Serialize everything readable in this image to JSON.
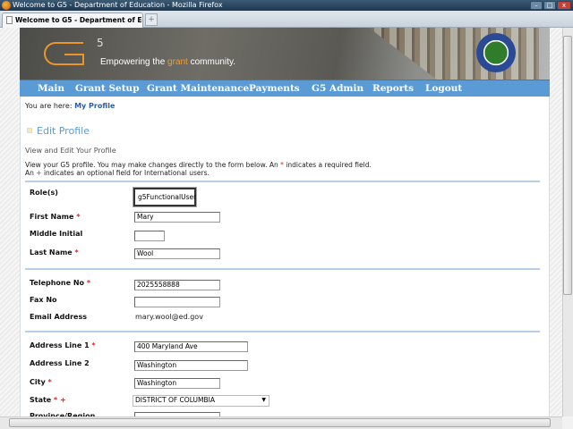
{
  "window": {
    "title": "Welcome to G5 - Department of Education - Mozilla Firefox",
    "tab_label": "Welcome to G5 - Department of Edu...",
    "new_tab": "+"
  },
  "banner": {
    "logo_sup": "5",
    "tagline_pre": "Empowering the ",
    "tagline_hl": "grant",
    "tagline_post": " community."
  },
  "nav": [
    "Main",
    "Grant Setup",
    "Grant Maintenance",
    "Payments",
    "G5 Admin",
    "Reports",
    "Logout"
  ],
  "breadcrumb": {
    "prefix": "You are here:",
    "current": "My Profile"
  },
  "page": {
    "title": "Edit Profile",
    "subtitle": "View and Edit Your Profile",
    "intro1_pre": "View your G5 profile. You may make changes directly to the form below. An ",
    "intro1_mark": "*",
    "intro1_post": " indicates a required field.",
    "intro2_pre": "An ",
    "intro2_mark": "+",
    "intro2_post": " indicates an optional field for International users."
  },
  "form": {
    "roles": {
      "label": "Role(s)",
      "value": "g5FunctionalUser"
    },
    "first_name": {
      "label": "First Name",
      "value": "Mary"
    },
    "middle_initial": {
      "label": "Middle Initial",
      "value": ""
    },
    "last_name": {
      "label": "Last Name",
      "value": "Wool"
    },
    "telephone": {
      "label": "Telephone No",
      "value": "2025558888"
    },
    "fax": {
      "label": "Fax No",
      "value": ""
    },
    "email": {
      "label": "Email Address",
      "value": "mary.wool@ed.gov"
    },
    "address1": {
      "label": "Address Line 1",
      "value": "400 Maryland Ave"
    },
    "address2": {
      "label": "Address Line 2",
      "value": "Washington"
    },
    "city": {
      "label": "City",
      "value": "Washington"
    },
    "state": {
      "label": "State",
      "value": "DISTRICT OF COLUMBIA"
    },
    "province": {
      "label": "Province/Region",
      "value": ""
    },
    "required_mark": "*",
    "intl_mark": "+"
  }
}
